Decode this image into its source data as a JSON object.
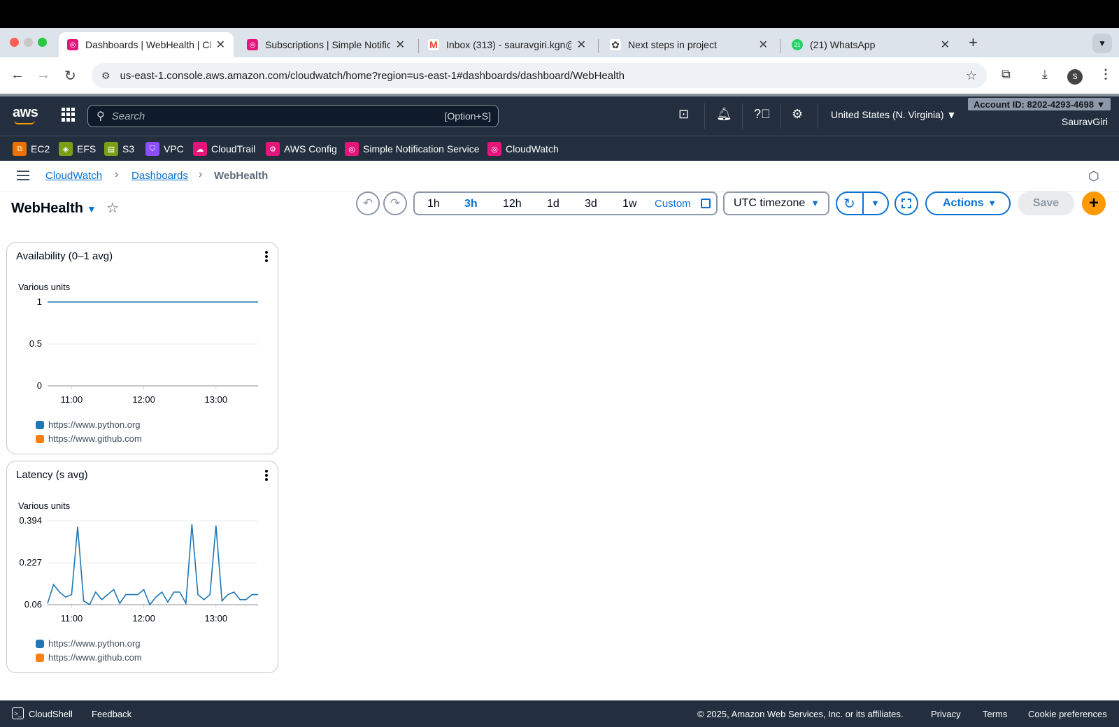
{
  "browser": {
    "tabs": [
      {
        "title": "Dashboards | WebHealth | Clo",
        "favicon_color": "#e7157b",
        "active": true
      },
      {
        "title": "Subscriptions | Simple Notific",
        "favicon_color": "#e7157b",
        "active": false
      },
      {
        "title": "Inbox (313) - sauravgiri.kgn@",
        "favicon_color": "#ea4335",
        "active": false
      },
      {
        "title": "Next steps in project",
        "favicon_color": "#444444",
        "active": false
      },
      {
        "title": "(21) WhatsApp",
        "favicon_color": "#25d366",
        "active": false
      }
    ],
    "url": "us-east-1.console.aws.amazon.com/cloudwatch/home?region=us-east-1#dashboards/dashboard/WebHealth",
    "profile_initial": "S"
  },
  "aws_header": {
    "logo": "aws",
    "search_placeholder": "Search",
    "search_shortcut": "[Option+S]",
    "region": "United States (N. Virginia) ▼",
    "account": "Account ID: 8202-4293-4698 ▼",
    "user": "SauravGiri"
  },
  "services": [
    {
      "label": "EC2",
      "color": "#ed7100"
    },
    {
      "label": "EFS",
      "color": "#7aa116"
    },
    {
      "label": "S3",
      "color": "#7aa116"
    },
    {
      "label": "VPC",
      "color": "#8c4fff"
    },
    {
      "label": "CloudTrail",
      "color": "#e7157b"
    },
    {
      "label": "AWS Config",
      "color": "#e7157b"
    },
    {
      "label": "Simple Notification Service",
      "color": "#e7157b"
    },
    {
      "label": "CloudWatch",
      "color": "#e7157b"
    }
  ],
  "breadcrumb": {
    "items": [
      "CloudWatch",
      "Dashboards"
    ],
    "current": "WebHealth"
  },
  "dashboard": {
    "title": "WebHealth",
    "ranges": [
      "1h",
      "3h",
      "12h",
      "1d",
      "3d",
      "1w"
    ],
    "selected_range": "3h",
    "custom_label": "Custom",
    "timezone": "UTC timezone",
    "actions_label": "Actions",
    "save_label": "Save",
    "add_label": "+"
  },
  "widgets": [
    {
      "title": "Availability (0–1 avg)",
      "units": "Various units"
    },
    {
      "title": "Latency (s avg)",
      "units": "Various units"
    }
  ],
  "chart_data": [
    {
      "type": "line",
      "title": "Availability (0–1 avg)",
      "ylabel": "Various units",
      "ylim": [
        0,
        1
      ],
      "yticks": [
        "1",
        "0.5",
        "0"
      ],
      "xticks": [
        "11:00",
        "12:00",
        "13:00"
      ],
      "x": [
        "10:40",
        "10:50",
        "11:00",
        "11:10",
        "11:20",
        "11:30",
        "11:40",
        "11:50",
        "12:00",
        "12:10",
        "12:20",
        "12:30",
        "12:40",
        "12:50",
        "13:00",
        "13:10",
        "13:20",
        "13:30",
        "13:35"
      ],
      "series": [
        {
          "name": "https://www.python.org",
          "color": "#1f77b4",
          "values": [
            1,
            1,
            1,
            1,
            1,
            1,
            1,
            1,
            1,
            1,
            1,
            1,
            1,
            1,
            1,
            1,
            1,
            1,
            1
          ]
        },
        {
          "name": "https://www.github.com",
          "color": "#ff7f0e",
          "values": []
        }
      ],
      "grid": true,
      "legend": "bottom"
    },
    {
      "type": "line",
      "title": "Latency (s avg)",
      "ylabel": "Various units",
      "ylim": [
        0.06,
        0.394
      ],
      "yticks": [
        "0.394",
        "0.227",
        "0.06"
      ],
      "xticks": [
        "11:00",
        "12:00",
        "13:00"
      ],
      "x": [
        "10:40",
        "10:45",
        "10:50",
        "10:55",
        "11:00",
        "11:05",
        "11:10",
        "11:15",
        "11:20",
        "11:25",
        "11:30",
        "11:35",
        "11:40",
        "11:45",
        "11:50",
        "11:55",
        "12:00",
        "12:05",
        "12:10",
        "12:15",
        "12:20",
        "12:25",
        "12:30",
        "12:35",
        "12:40",
        "12:45",
        "12:50",
        "12:55",
        "13:00",
        "13:05",
        "13:10",
        "13:15",
        "13:20",
        "13:25",
        "13:30",
        "13:35"
      ],
      "series": [
        {
          "name": "https://www.python.org",
          "color": "#1f77b4",
          "values": [
            0.065,
            0.14,
            0.11,
            0.09,
            0.1,
            0.37,
            0.075,
            0.06,
            0.11,
            0.08,
            0.1,
            0.12,
            0.065,
            0.1,
            0.1,
            0.1,
            0.12,
            0.06,
            0.09,
            0.11,
            0.07,
            0.11,
            0.11,
            0.065,
            0.38,
            0.1,
            0.08,
            0.1,
            0.375,
            0.075,
            0.1,
            0.11,
            0.08,
            0.08,
            0.1,
            0.1
          ]
        },
        {
          "name": "https://www.github.com",
          "color": "#ff7f0e",
          "values": []
        }
      ],
      "grid": true,
      "legend": "bottom"
    }
  ],
  "footer": {
    "cloudshell": "CloudShell",
    "feedback": "Feedback",
    "copyright": "© 2025, Amazon Web Services, Inc. or its affiliates.",
    "privacy": "Privacy",
    "terms": "Terms",
    "cookies": "Cookie preferences"
  }
}
